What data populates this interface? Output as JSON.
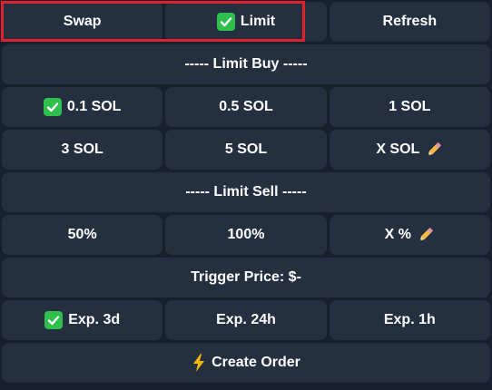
{
  "top": {
    "swap_label": "Swap",
    "limit_label": "Limit",
    "refresh_label": "Refresh"
  },
  "buy": {
    "header_label": "----- Limit Buy -----",
    "options": [
      "0.1 SOL",
      "0.5 SOL",
      "1 SOL",
      "3 SOL",
      "5 SOL",
      "X SOL"
    ]
  },
  "sell": {
    "header_label": "----- Limit Sell -----",
    "options": [
      "50%",
      "100%",
      "X %"
    ]
  },
  "trigger": {
    "label": "Trigger Price: $-"
  },
  "expiry": {
    "options": [
      "Exp. 3d",
      "Exp. 24h",
      "Exp. 1h"
    ]
  },
  "create": {
    "label": "Create Order"
  },
  "colors": {
    "background": "#17212b",
    "button": "#243040",
    "check": "#2fbf4c",
    "highlight": "#e0202a",
    "text": "#ffffff"
  },
  "icons": {
    "check": "check-mark-icon",
    "pencil": "pencil-icon",
    "bolt": "lightning-bolt-icon"
  }
}
